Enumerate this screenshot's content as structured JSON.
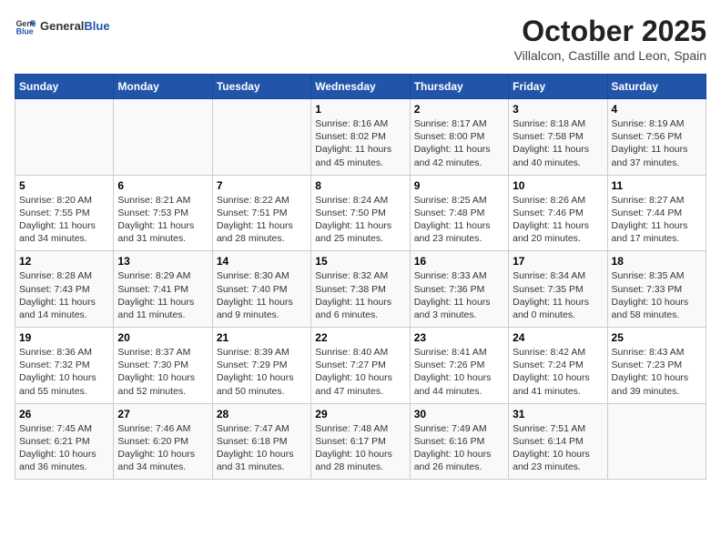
{
  "logo": {
    "general": "General",
    "blue": "Blue"
  },
  "title": "October 2025",
  "subtitle": "Villalcon, Castille and Leon, Spain",
  "days_header": [
    "Sunday",
    "Monday",
    "Tuesday",
    "Wednesday",
    "Thursday",
    "Friday",
    "Saturday"
  ],
  "weeks": [
    [
      {
        "day": "",
        "info": ""
      },
      {
        "day": "",
        "info": ""
      },
      {
        "day": "",
        "info": ""
      },
      {
        "day": "1",
        "info": "Sunrise: 8:16 AM\nSunset: 8:02 PM\nDaylight: 11 hours and 45 minutes."
      },
      {
        "day": "2",
        "info": "Sunrise: 8:17 AM\nSunset: 8:00 PM\nDaylight: 11 hours and 42 minutes."
      },
      {
        "day": "3",
        "info": "Sunrise: 8:18 AM\nSunset: 7:58 PM\nDaylight: 11 hours and 40 minutes."
      },
      {
        "day": "4",
        "info": "Sunrise: 8:19 AM\nSunset: 7:56 PM\nDaylight: 11 hours and 37 minutes."
      }
    ],
    [
      {
        "day": "5",
        "info": "Sunrise: 8:20 AM\nSunset: 7:55 PM\nDaylight: 11 hours and 34 minutes."
      },
      {
        "day": "6",
        "info": "Sunrise: 8:21 AM\nSunset: 7:53 PM\nDaylight: 11 hours and 31 minutes."
      },
      {
        "day": "7",
        "info": "Sunrise: 8:22 AM\nSunset: 7:51 PM\nDaylight: 11 hours and 28 minutes."
      },
      {
        "day": "8",
        "info": "Sunrise: 8:24 AM\nSunset: 7:50 PM\nDaylight: 11 hours and 25 minutes."
      },
      {
        "day": "9",
        "info": "Sunrise: 8:25 AM\nSunset: 7:48 PM\nDaylight: 11 hours and 23 minutes."
      },
      {
        "day": "10",
        "info": "Sunrise: 8:26 AM\nSunset: 7:46 PM\nDaylight: 11 hours and 20 minutes."
      },
      {
        "day": "11",
        "info": "Sunrise: 8:27 AM\nSunset: 7:44 PM\nDaylight: 11 hours and 17 minutes."
      }
    ],
    [
      {
        "day": "12",
        "info": "Sunrise: 8:28 AM\nSunset: 7:43 PM\nDaylight: 11 hours and 14 minutes."
      },
      {
        "day": "13",
        "info": "Sunrise: 8:29 AM\nSunset: 7:41 PM\nDaylight: 11 hours and 11 minutes."
      },
      {
        "day": "14",
        "info": "Sunrise: 8:30 AM\nSunset: 7:40 PM\nDaylight: 11 hours and 9 minutes."
      },
      {
        "day": "15",
        "info": "Sunrise: 8:32 AM\nSunset: 7:38 PM\nDaylight: 11 hours and 6 minutes."
      },
      {
        "day": "16",
        "info": "Sunrise: 8:33 AM\nSunset: 7:36 PM\nDaylight: 11 hours and 3 minutes."
      },
      {
        "day": "17",
        "info": "Sunrise: 8:34 AM\nSunset: 7:35 PM\nDaylight: 11 hours and 0 minutes."
      },
      {
        "day": "18",
        "info": "Sunrise: 8:35 AM\nSunset: 7:33 PM\nDaylight: 10 hours and 58 minutes."
      }
    ],
    [
      {
        "day": "19",
        "info": "Sunrise: 8:36 AM\nSunset: 7:32 PM\nDaylight: 10 hours and 55 minutes."
      },
      {
        "day": "20",
        "info": "Sunrise: 8:37 AM\nSunset: 7:30 PM\nDaylight: 10 hours and 52 minutes."
      },
      {
        "day": "21",
        "info": "Sunrise: 8:39 AM\nSunset: 7:29 PM\nDaylight: 10 hours and 50 minutes."
      },
      {
        "day": "22",
        "info": "Sunrise: 8:40 AM\nSunset: 7:27 PM\nDaylight: 10 hours and 47 minutes."
      },
      {
        "day": "23",
        "info": "Sunrise: 8:41 AM\nSunset: 7:26 PM\nDaylight: 10 hours and 44 minutes."
      },
      {
        "day": "24",
        "info": "Sunrise: 8:42 AM\nSunset: 7:24 PM\nDaylight: 10 hours and 41 minutes."
      },
      {
        "day": "25",
        "info": "Sunrise: 8:43 AM\nSunset: 7:23 PM\nDaylight: 10 hours and 39 minutes."
      }
    ],
    [
      {
        "day": "26",
        "info": "Sunrise: 7:45 AM\nSunset: 6:21 PM\nDaylight: 10 hours and 36 minutes."
      },
      {
        "day": "27",
        "info": "Sunrise: 7:46 AM\nSunset: 6:20 PM\nDaylight: 10 hours and 34 minutes."
      },
      {
        "day": "28",
        "info": "Sunrise: 7:47 AM\nSunset: 6:18 PM\nDaylight: 10 hours and 31 minutes."
      },
      {
        "day": "29",
        "info": "Sunrise: 7:48 AM\nSunset: 6:17 PM\nDaylight: 10 hours and 28 minutes."
      },
      {
        "day": "30",
        "info": "Sunrise: 7:49 AM\nSunset: 6:16 PM\nDaylight: 10 hours and 26 minutes."
      },
      {
        "day": "31",
        "info": "Sunrise: 7:51 AM\nSunset: 6:14 PM\nDaylight: 10 hours and 23 minutes."
      },
      {
        "day": "",
        "info": ""
      }
    ]
  ]
}
